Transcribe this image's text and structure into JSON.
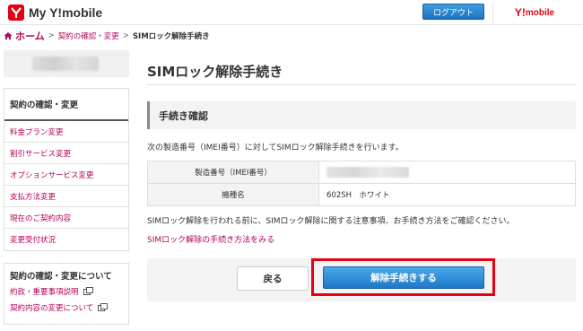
{
  "header": {
    "logo_text": "My Y!mobile",
    "logout_label": "ログアウト",
    "brand_mark": "Y!",
    "brand_text": "mobile"
  },
  "breadcrumb": {
    "home": "ホーム",
    "items": [
      "契約の確認・変更",
      "SIMロック解除手続き"
    ],
    "separator": ">"
  },
  "sidebar": {
    "menu_title": "契約の確認・変更",
    "items": [
      {
        "label": "料金プラン変更"
      },
      {
        "label": "割引サービス変更"
      },
      {
        "label": "オプションサービス変更"
      },
      {
        "label": "支払方法変更"
      },
      {
        "label": "現在のご契約内容"
      },
      {
        "label": "変更受付状況"
      }
    ],
    "about_title": "契約の確認・変更について",
    "about_links": [
      {
        "label": "約款・重要事項説明"
      },
      {
        "label": "契約内容の変更について"
      }
    ]
  },
  "main": {
    "page_title": "SIMロック解除手続き",
    "section_title": "手続き確認",
    "intro": "次の製造番号（IMEI番号）に対してSIMロック解除手続きを行います。",
    "table": [
      {
        "label": "製造番号（IMEI番号）",
        "value": ""
      },
      {
        "label": "機種名",
        "value": "602SH　ホワイト"
      }
    ],
    "notice": "SIMロック解除を行われる前に、SIMロック解除に関する注意事項、お手続き方法をご確認ください。",
    "procedure_link": "SIMロック解除の手続き方法をみる",
    "back_label": "戻る",
    "submit_label": "解除手続きする"
  },
  "colors": {
    "accent": "#b5005b",
    "brand_red": "#e60012",
    "button_blue": "#1e78c6"
  }
}
